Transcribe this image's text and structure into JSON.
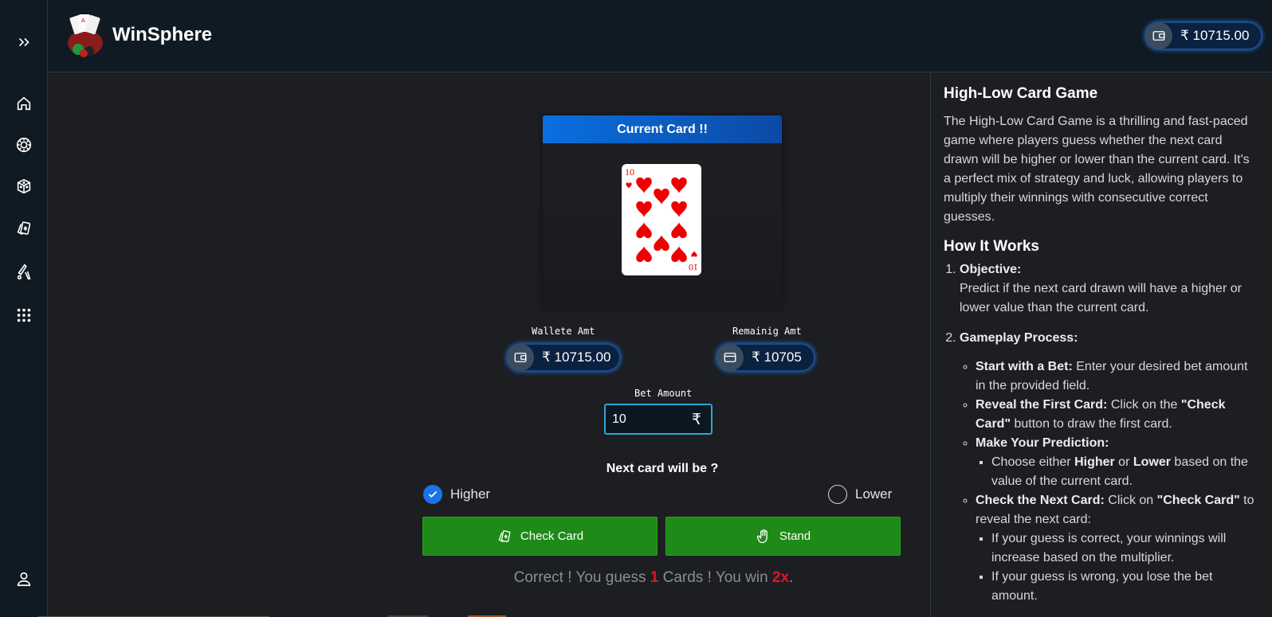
{
  "header": {
    "brand": "WinSphere",
    "wallet": "₹ 10715.00"
  },
  "sidebar": {
    "items": [
      {
        "icon": "expand-icon"
      },
      {
        "icon": "home-icon"
      },
      {
        "icon": "roulette-icon"
      },
      {
        "icon": "dice-icon"
      },
      {
        "icon": "cards-icon"
      },
      {
        "icon": "cricket-icon"
      },
      {
        "icon": "apps-grid-icon"
      },
      {
        "icon": "user-icon"
      }
    ]
  },
  "game": {
    "card_panel_title": "Current Card !!",
    "current_card": {
      "rank": "10",
      "suit": "hearts"
    },
    "wallet_label": "Wallete Amt",
    "wallet_value": "₹ 10715.00",
    "remaining_label": "Remainig Amt",
    "remaining_value": "₹ 10705",
    "bet_label": "Bet Amount",
    "bet_value": "10",
    "bet_currency": "₹",
    "question": "Next card will be ?",
    "options": {
      "higher": "Higher",
      "lower": "Lower",
      "selected": "higher"
    },
    "check_button": "Check Card",
    "stand_button": "Stand",
    "result": {
      "prefix": "Correct ! You guess ",
      "count": "1",
      "middle": " Cards ! You win ",
      "multiplier": "2x",
      "suffix": "."
    }
  },
  "info": {
    "title": "High-Low Card Game",
    "description": "The High-Low Card Game is a thrilling and fast-paced game where players guess whether the next card drawn will be higher or lower than the current card. It's a perfect mix of strategy and luck, allowing players to multiply their winnings with consecutive correct guesses.",
    "how_title": "How It Works",
    "objective_title": "Objective:",
    "objective_text": "Predict if the next card drawn will have a higher or lower value than the current card.",
    "process_title": "Gameplay Process:",
    "step1_bold": "Start with a Bet:",
    "step1_text": " Enter your desired bet amount in the provided field.",
    "step2_bold": "Reveal the First Card:",
    "step2_text": " Click on the ",
    "step2_quote": "\"Check Card\"",
    "step2_after": " button to draw the first card.",
    "step3_bold": "Make Your Prediction:",
    "step3_sub_pre": "Choose either ",
    "step3_sub_higher": "Higher",
    "step3_sub_or": " or ",
    "step3_sub_lower": "Lower",
    "step3_sub_post": " based on the value of the current card.",
    "step4_bold": "Check the Next Card:",
    "step4_text": " Click on ",
    "step4_quote": "\"Check Card\"",
    "step4_after": " to reveal the next card:",
    "step4_sub1": "If your guess is correct, your winnings will increase based on the multiplier.",
    "step4_sub2": "If your guess is wrong, you lose the bet amount."
  },
  "colors": {
    "accent_blue": "#1a73e8",
    "button_green": "#1e8a18",
    "highlight_red": "#e0142a"
  }
}
